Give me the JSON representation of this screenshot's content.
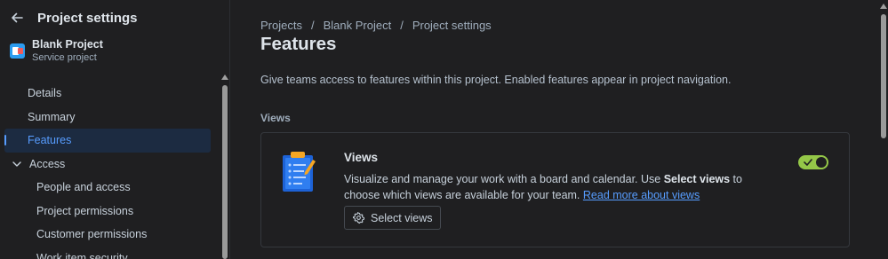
{
  "sidebar": {
    "title": "Project settings",
    "project": {
      "name": "Blank Project",
      "type": "Service project"
    },
    "items": [
      {
        "label": "Details"
      },
      {
        "label": "Summary"
      },
      {
        "label": "Features",
        "active": true
      },
      {
        "label": "Access",
        "expanded": true
      },
      {
        "label": "People and access"
      },
      {
        "label": "Project permissions"
      },
      {
        "label": "Customer permissions"
      },
      {
        "label": "Work item security"
      }
    ]
  },
  "breadcrumb": [
    "Projects",
    "Blank Project",
    "Project settings"
  ],
  "page": {
    "title": "Features",
    "description": "Give teams access to features within this project. Enabled features appear in project navigation.",
    "section_label": "Views"
  },
  "card": {
    "title": "Views",
    "desc_part1": "Visualize and manage your work with a board and calendar. Use ",
    "desc_bold": "Select views",
    "desc_part2": " to choose which views are available for your team. ",
    "link": "Read more about views",
    "button_label": "Select views",
    "toggle_on": true
  },
  "colors": {
    "accent": "#579dff",
    "toggle_on": "#94c748",
    "background": "#1f1f21"
  }
}
